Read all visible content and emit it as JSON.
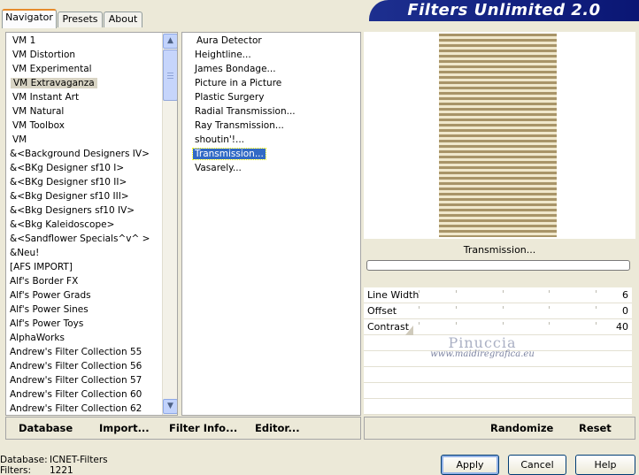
{
  "tabs": [
    {
      "label": "Navigator",
      "active": true
    },
    {
      "label": "Presets",
      "active": false
    },
    {
      "label": "About",
      "active": false
    }
  ],
  "app_title": "Filters Unlimited 2.0",
  "categories": [
    "VM 1",
    "VM Distortion",
    "VM Experimental",
    "VM Extravaganza",
    "VM Instant Art",
    "VM Natural",
    "VM Toolbox",
    "VM",
    "&<Background Designers IV>",
    "&<BKg Designer sf10 I>",
    "&<BKg Designer sf10 II>",
    "&<Bkg Designer sf10 III>",
    "&<Bkg Designers sf10 IV>",
    "&<Bkg Kaleidoscope>",
    "&<Sandflower Specials^v^ >",
    "&Neu!",
    "[AFS IMPORT]",
    "Alf's Border FX",
    "Alf's Power Grads",
    "Alf's Power Sines",
    "Alf's Power Toys",
    "AlphaWorks",
    "Andrew's Filter Collection 55",
    "Andrew's Filter Collection 56",
    "Andrew's Filter Collection 57",
    "Andrew's Filter Collection 60",
    "Andrew's Filter Collection 62"
  ],
  "selected_category": "VM Extravaganza",
  "filters": [
    "Aura Detector",
    "Heightline...",
    "James Bondage...",
    "Picture in a Picture",
    "Plastic Surgery",
    "Radial Transmission...",
    "Ray Transmission...",
    "shoutin'!...",
    "Transmission...",
    "Vasarely..."
  ],
  "selected_filter": "Transmission...",
  "preview": {
    "caption": "Transmission...",
    "progress": 0
  },
  "params": [
    {
      "label": "Line Width",
      "value": "6",
      "level": 6,
      "max": 255
    },
    {
      "label": "Offset",
      "value": "0",
      "level": 0,
      "max": 255
    },
    {
      "label": "Contrast",
      "value": "40",
      "level": 0,
      "max": 255
    }
  ],
  "watermark": {
    "name": "Pinuccia",
    "url": "www.maidiregrafica.eu"
  },
  "left_bar": {
    "database": "Database",
    "import": "Import...",
    "filter_info": "Filter Info...",
    "editor": "Editor..."
  },
  "right_bar": {
    "randomize": "Randomize",
    "reset": "Reset"
  },
  "status": {
    "database_label": "Database:",
    "database_value": "ICNET-Filters",
    "filters_label": "Filters:",
    "filters_value": "1221"
  },
  "dialog": {
    "apply": "Apply",
    "cancel": "Cancel",
    "help": "Help"
  },
  "colors": {
    "accent": "#316ac5",
    "banner": "#0a1674",
    "stripe_dark": "#a89468",
    "stripe_light": "#f0e8cc"
  }
}
